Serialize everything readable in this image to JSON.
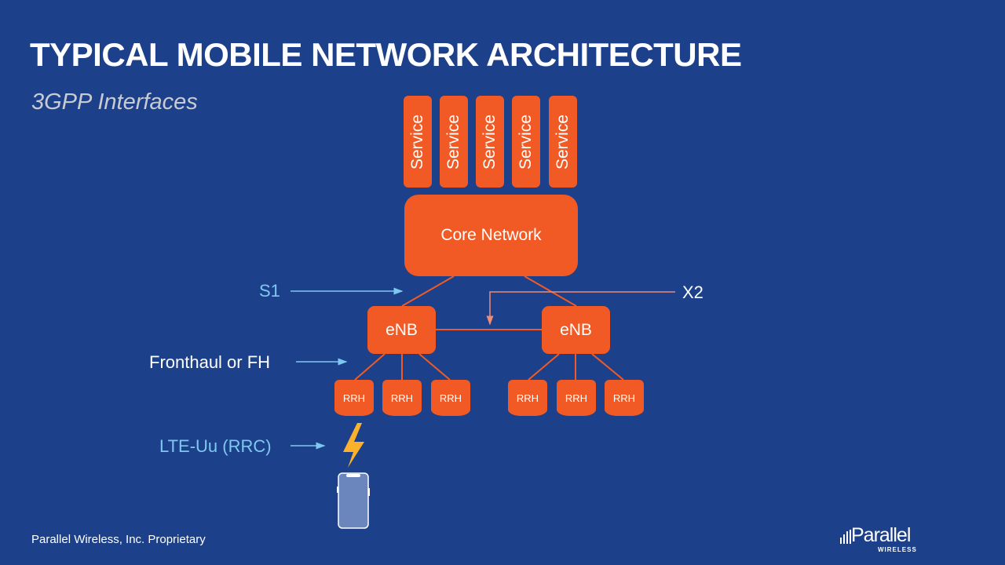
{
  "slide": {
    "title": "TYPICAL MOBILE NETWORK ARCHITECTURE",
    "subtitle": "3GPP Interfaces",
    "footer": "Parallel Wireless, Inc. Proprietary"
  },
  "diagram": {
    "services": [
      "Service",
      "Service",
      "Service",
      "Service",
      "Service"
    ],
    "core": "Core Network",
    "enb_left": "eNB",
    "enb_right": "eNB",
    "rrh_left": [
      "RRH",
      "RRH",
      "RRH"
    ],
    "rrh_right": [
      "RRH",
      "RRH",
      "RRH"
    ],
    "interfaces": {
      "s1": "S1",
      "x2": "X2",
      "fronthaul": "Fronthaul or FH",
      "lte_uu": "LTE-Uu (RRC)"
    },
    "icons": {
      "lightning": "lightning-icon",
      "phone": "smartphone-icon"
    }
  },
  "logo": {
    "name": "Parallel",
    "sub": "WIRELESS"
  },
  "colors": {
    "background": "#1c418a",
    "accent": "#f15a24",
    "interface_label": "#7ec8f0",
    "lightning": "#fbb12b"
  }
}
